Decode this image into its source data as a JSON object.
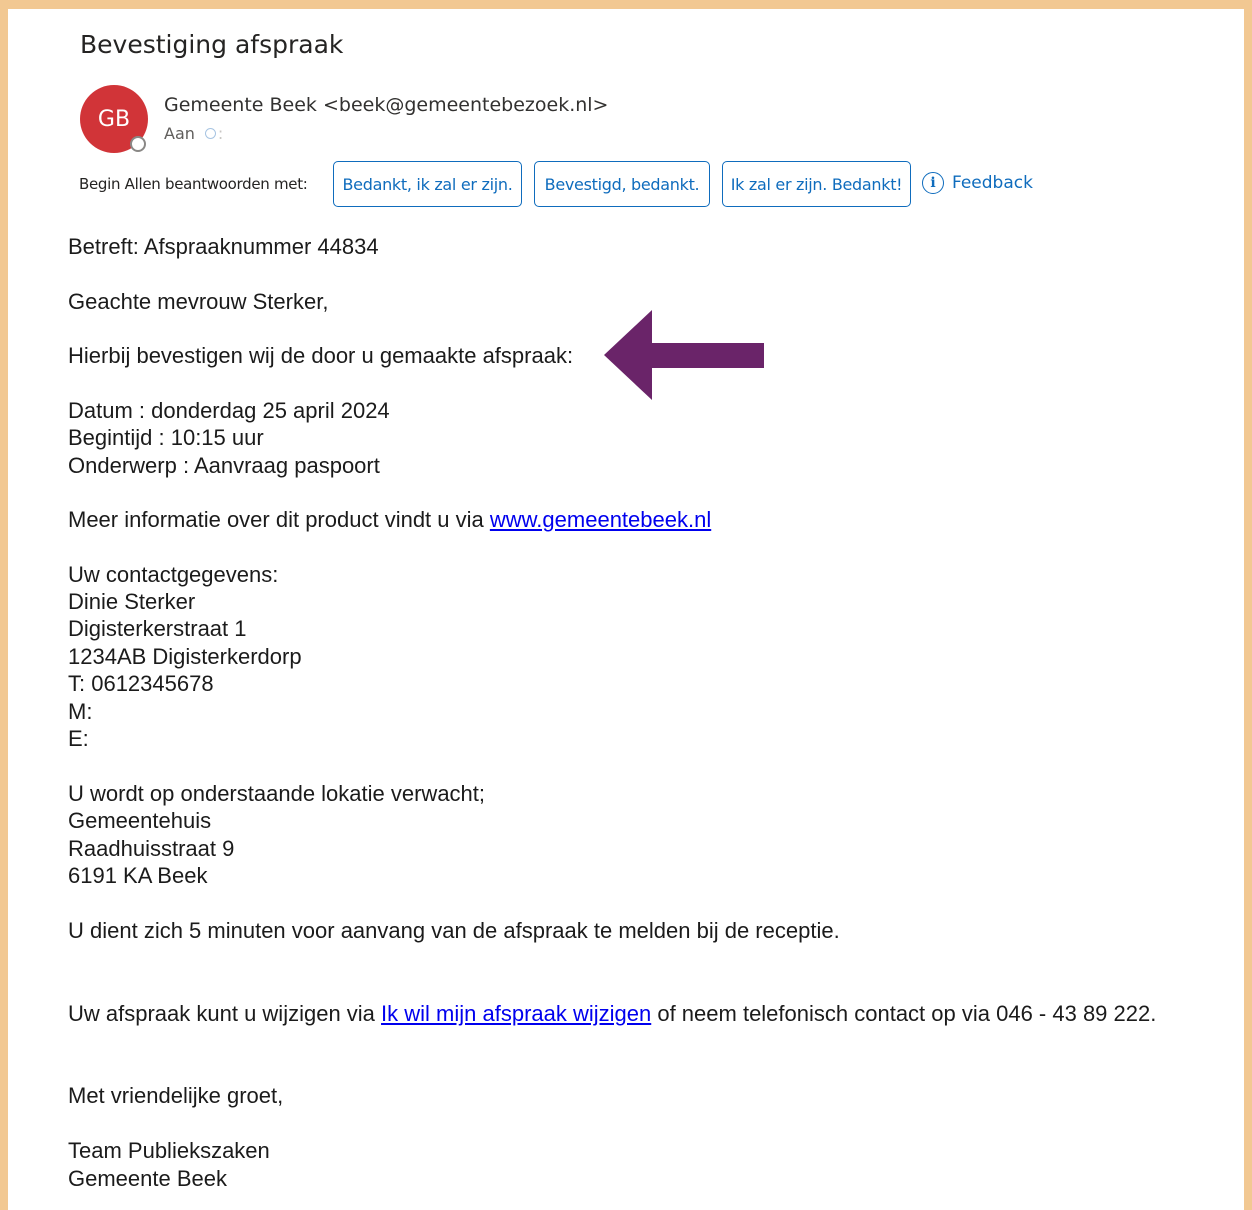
{
  "email": {
    "subject": "Bevestiging afspraak",
    "avatar_initials": "GB",
    "sender": "Gemeente Beek <beek@gemeentebezoek.nl>",
    "to_label": "Aan",
    "to_separator": ":"
  },
  "quick_replies": {
    "label": "Begin Allen beantwoorden met:",
    "options": [
      "Bedankt, ik zal er zijn.",
      "Bevestigd, bedankt.",
      "Ik zal er zijn. Bedankt!"
    ],
    "feedback": "Feedback"
  },
  "body": {
    "regarding": "Betreft: Afspraaknummer 44834",
    "greeting": "Geachte mevrouw Sterker,",
    "intro": "Hierbij bevestigen wij de door u gemaakte afspraak:",
    "date": "Datum : donderdag 25 april 2024",
    "start_time": "Begintijd : 10:15 uur",
    "topic": "Onderwerp : Aanvraag paspoort",
    "more_info_prefix": "Meer informatie over dit product vindt u via ",
    "more_info_link": "www.gemeentebeek.nl",
    "contact_heading": "Uw contactgegevens:",
    "contact_name": "Dinie Sterker",
    "contact_street": "Digisterkerstraat 1",
    "contact_city": "1234AB Digisterkerdorp",
    "contact_phone": "T: 0612345678",
    "contact_mobile": "M:",
    "contact_email": "E:",
    "location_heading": "U wordt op onderstaande lokatie verwacht;",
    "location_name": "Gemeentehuis",
    "location_street": "Raadhuisstraat 9",
    "location_city": "6191 KA Beek",
    "arrival_note": "U dient zich 5 minuten voor aanvang van de afspraak te melden bij de receptie.",
    "change_prefix": "Uw afspraak kunt u wijzigen via ",
    "change_link": "Ik wil mijn afspraak wijzigen",
    "change_suffix": " of neem telefonisch contact op via 046 - 43 89 222.",
    "closing": "Met vriendelijke groet,",
    "signature_team": "Team Publiekszaken",
    "signature_org": "Gemeente Beek"
  },
  "annotation": {
    "arrow_color": "#6a2469",
    "frame_color": "#f2c892"
  }
}
